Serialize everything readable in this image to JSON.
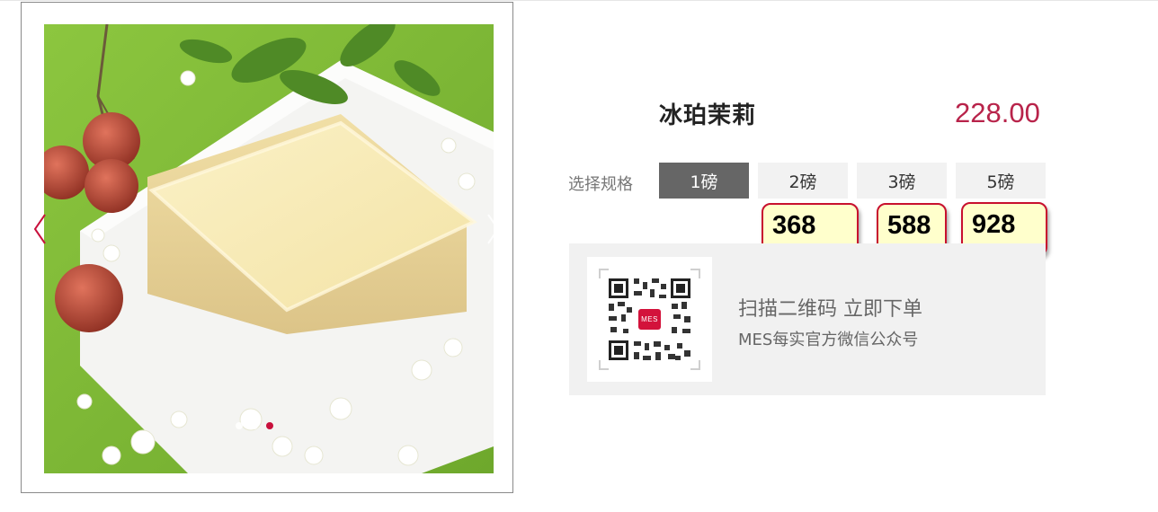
{
  "product": {
    "name": "冰珀茉莉",
    "price": "228.00"
  },
  "specs": {
    "label": "选择规格",
    "options": [
      {
        "label": "1磅",
        "selected": true
      },
      {
        "label": "2磅",
        "selected": false
      },
      {
        "label": "3磅",
        "selected": false
      },
      {
        "label": "5磅",
        "selected": false
      }
    ]
  },
  "annotations": [
    "368",
    "588",
    "928"
  ],
  "gallery": {
    "slide_count": 3,
    "active_slide": 3,
    "prev_icon": "chevron-left-icon",
    "next_icon": "chevron-right-icon"
  },
  "qr": {
    "badge": "MES",
    "main_text": "扫描二维码 立即下单",
    "sub_text": "MES每实官方微信公众号"
  },
  "colors": {
    "accent": "#b8234a",
    "selected_spec": "#666666",
    "annotation_border": "#c8102e",
    "annotation_fill": "#ffffcc"
  }
}
